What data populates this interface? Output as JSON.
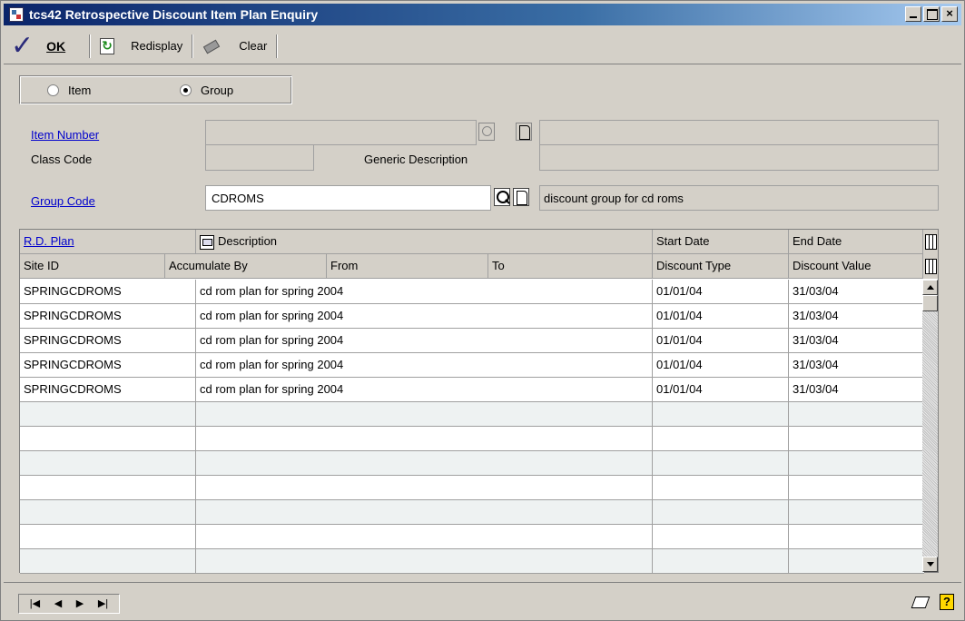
{
  "window": {
    "title": "tcs42 Retrospective Discount Item Plan Enquiry",
    "close_glyph": "×"
  },
  "toolbar": {
    "check_glyph": "✓",
    "ok_label": "OK",
    "redisplay_label": "Redisplay",
    "clear_label": "Clear"
  },
  "options": {
    "item_label": "Item",
    "group_label": "Group",
    "selected": "Group"
  },
  "form": {
    "item_number_label": "Item Number",
    "item_number_value": "",
    "item_description_value": "",
    "class_code_label": "Class Code",
    "class_code_value": "",
    "generic_description_label": "Generic Description",
    "generic_description_value": "",
    "group_code_label": "Group Code",
    "group_code_value": "CDROMS",
    "group_code_description": "discount group for cd roms"
  },
  "grid": {
    "header1": {
      "rd_plan": "R.D. Plan",
      "description": "Description",
      "start_date": "Start Date",
      "end_date": "End Date"
    },
    "header2": {
      "site_id": "Site ID",
      "accumulate_by": "Accumulate By",
      "from": "From",
      "to": "To",
      "discount_type": "Discount Type",
      "discount_value": "Discount Value"
    },
    "rows": [
      {
        "plan": "SPRINGCDROMS",
        "description": "cd rom plan for spring 2004",
        "start": "01/01/04",
        "end": "31/03/04"
      },
      {
        "plan": "SPRINGCDROMS",
        "description": "cd rom plan for spring 2004",
        "start": "01/01/04",
        "end": "31/03/04"
      },
      {
        "plan": "SPRINGCDROMS",
        "description": "cd rom plan for spring 2004",
        "start": "01/01/04",
        "end": "31/03/04"
      },
      {
        "plan": "SPRINGCDROMS",
        "description": "cd rom plan for spring 2004",
        "start": "01/01/04",
        "end": "31/03/04"
      },
      {
        "plan": "SPRINGCDROMS",
        "description": "cd rom plan for spring 2004",
        "start": "01/01/04",
        "end": "31/03/04"
      }
    ],
    "empty_rows": 7
  },
  "navigation": {
    "first": "|◀",
    "prev": "◀",
    "next": "▶",
    "last": "▶|"
  },
  "status": {
    "help_glyph": "?"
  },
  "colors": {
    "title_start": "#0a246a",
    "title_end": "#a6caf0",
    "link": "#0000cc",
    "face": "#d4d0c8"
  }
}
